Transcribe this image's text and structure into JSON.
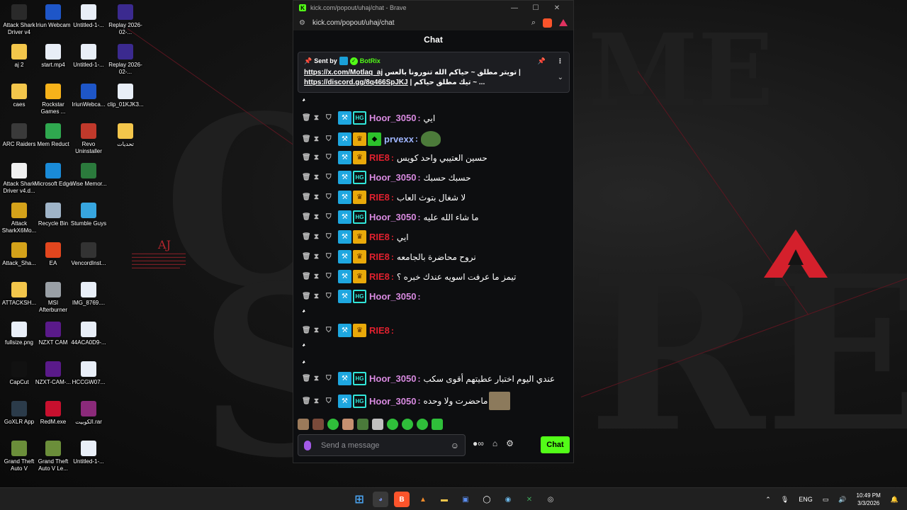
{
  "desktop": {
    "icons": [
      {
        "label": "Attack Shark Driver v4",
        "icon": "mouse-driver-icon",
        "color": "#2a2a2a"
      },
      {
        "label": "Iriun Webcam",
        "icon": "webcam-icon",
        "color": "#1e56c8"
      },
      {
        "label": "Untitled-1-...",
        "icon": "image-file-icon",
        "color": "#e8eef7"
      },
      {
        "label": "Replay 2026-02-...",
        "icon": "video-file-icon",
        "color": "#3b2a8f"
      },
      {
        "label": "aj 2",
        "icon": "folder-icon",
        "color": "#f3c64b"
      },
      {
        "label": "start.mp4",
        "icon": "video-file-icon",
        "color": "#e8eef7"
      },
      {
        "label": "Untitled-1-...",
        "icon": "image-file-icon",
        "color": "#e8eef7"
      },
      {
        "label": "Replay 2026-02-...",
        "icon": "video-file-icon",
        "color": "#3b2a8f"
      },
      {
        "label": "caes",
        "icon": "folder-icon",
        "color": "#f3c64b"
      },
      {
        "label": "Rockstar Games ...",
        "icon": "rockstar-icon",
        "color": "#f6b21a"
      },
      {
        "label": "IriunWebca...",
        "icon": "webcam-icon",
        "color": "#1e56c8"
      },
      {
        "label": "clip_01KJK3...",
        "icon": "video-file-icon",
        "color": "#e8eef7"
      },
      {
        "label": "ARC Raiders",
        "icon": "game-icon",
        "color": "#3a3a3a"
      },
      {
        "label": "Mem Reduct",
        "icon": "memory-icon",
        "color": "#2fa84f"
      },
      {
        "label": "Revo Uninstaller",
        "icon": "uninstaller-icon",
        "color": "#c0392b"
      },
      {
        "label": "تحديات",
        "icon": "folder-icon",
        "color": "#f3c64b"
      },
      {
        "label": "Attack Shark Driver v4.d...",
        "icon": "file-icon",
        "color": "#f0f0f0"
      },
      {
        "label": "Microsoft Edge",
        "icon": "edge-icon",
        "color": "#1a8bd8"
      },
      {
        "label": "Wise Memor...",
        "icon": "memory-icon",
        "color": "#2b7a3c"
      },
      {
        "label": "Attack SharkX6Mo...",
        "icon": "mouse-driver-icon",
        "color": "#d4a21a"
      },
      {
        "label": "Recycle Bin",
        "icon": "recycle-bin-icon",
        "color": "#9fb4c8"
      },
      {
        "label": "Stumble Guys",
        "icon": "game-icon",
        "color": "#37a6e0"
      },
      {
        "label": "Attack_Sha...",
        "icon": "mouse-driver-icon",
        "color": "#d4a21a"
      },
      {
        "label": "EA",
        "icon": "ea-icon",
        "color": "#e2461e"
      },
      {
        "label": "VencordInst...",
        "icon": "vencord-icon",
        "color": "#333333"
      },
      {
        "label": "ATTACKSH...",
        "icon": "folder-icon",
        "color": "#f3c64b"
      },
      {
        "label": "MSI Afterburner",
        "icon": "afterburner-icon",
        "color": "#9aa0a6"
      },
      {
        "label": "IMG_8769....",
        "icon": "image-file-icon",
        "color": "#e8eef7"
      },
      {
        "label": "fullsize.png",
        "icon": "image-file-icon",
        "color": "#e8eef7"
      },
      {
        "label": "NZXT CAM",
        "icon": "nzxt-icon",
        "color": "#5a1a8a"
      },
      {
        "label": "44ACA0D9-...",
        "icon": "image-file-icon",
        "color": "#e8eef7"
      },
      {
        "label": "CapCut",
        "icon": "capcut-icon",
        "color": "#111111"
      },
      {
        "label": "NZXT-CAM-...",
        "icon": "nzxt-icon",
        "color": "#5a1a8a"
      },
      {
        "label": "HCCGW07...",
        "icon": "image-file-icon",
        "color": "#e8eef7"
      },
      {
        "label": "GoXLR App",
        "icon": "goxlr-icon",
        "color": "#2b3b4a"
      },
      {
        "label": "RedM.exe",
        "icon": "redm-icon",
        "color": "#c8102e"
      },
      {
        "label": "الكوبيت.rar",
        "icon": "archive-icon",
        "color": "#8b2a7a"
      },
      {
        "label": "Grand Theft Auto V",
        "icon": "gta-icon",
        "color": "#6b8e3a"
      },
      {
        "label": "Grand Theft Auto V Le...",
        "icon": "gta-icon",
        "color": "#6b8e3a"
      },
      {
        "label": "Untitled-1-...",
        "icon": "image-file-icon",
        "color": "#e8eef7"
      }
    ],
    "aj_logo": "AJ"
  },
  "browser": {
    "title": "kick.com/popout/uhaj/chat - Brave",
    "url": "kick.com/popout/uhaj/chat",
    "minimize": "—",
    "maximize": "☐",
    "close": "✕"
  },
  "chat": {
    "header": "Chat",
    "pinned": {
      "sent_by_label": "Sent by",
      "bot_name": "BotRix",
      "line1_link": "https://x.com/Motlaq_aj",
      "line1_text": "تويتر مطلق ~ حياكم الله تنورونا بالعس |",
      "line2_link": "https://discord.gg/8q466SpJKJ",
      "line2_text": "| تيك مطلق حياكم ~ ..."
    },
    "messages": [
      {
        "user": "Hoor_3050",
        "color": "pink",
        "badges": [
          "mod",
          "sub"
        ],
        "text": "ايي"
      },
      {
        "user": "prvexx",
        "color": "blue",
        "badges": [
          "mod",
          "crown",
          "green"
        ],
        "text": ""
      },
      {
        "user": "RIE8",
        "color": "red",
        "badges": [
          "mod",
          "crown"
        ],
        "text": "حسين العتيبي واحد كويس"
      },
      {
        "user": "Hoor_3050",
        "color": "pink",
        "badges": [
          "mod",
          "sub"
        ],
        "text": "حسبك حسبك"
      },
      {
        "user": "RIE8",
        "color": "red",
        "badges": [
          "mod",
          "crown"
        ],
        "text": "لا شغال بتوث العاب"
      },
      {
        "user": "Hoor_3050",
        "color": "pink",
        "badges": [
          "mod",
          "sub"
        ],
        "text": "ما شاء الله عليه"
      },
      {
        "user": "RIE8",
        "color": "red",
        "badges": [
          "mod",
          "crown"
        ],
        "text": "ايي"
      },
      {
        "user": "RIE8",
        "color": "red",
        "badges": [
          "mod",
          "crown"
        ],
        "text": "نروح محاضرة بالجامعه"
      },
      {
        "user": "RIE8",
        "color": "red",
        "badges": [
          "mod",
          "crown"
        ],
        "text": "تيمز ما عرفت اسويه عندك خبره ؟"
      },
      {
        "user": "Hoor_3050",
        "color": "pink",
        "badges": [
          "mod",
          "sub"
        ],
        "text": ""
      },
      {
        "user": "RIE8",
        "color": "red",
        "badges": [
          "mod",
          "crown"
        ],
        "text": ""
      },
      {
        "user": "Hoor_3050",
        "color": "pink",
        "badges": [
          "mod",
          "sub"
        ],
        "text": "عندي اليوم اختبار عطيتهم أقوى سكب"
      },
      {
        "user": "Hoor_3050",
        "color": "pink",
        "badges": [
          "mod",
          "sub"
        ],
        "text": "ماحضرت ولا وحده"
      }
    ],
    "top_spam_line": "ٌٌٌٌٌٌٌٌٌٌٌٌٌٌٌٌٌٌٌٌٌٌٌٌٌٌٌٌٌٌٌٌٌٌٌٌٌٌٌٌٌٌٌٌٌٌٌٌٌٌٌٌٌٌ",
    "spam_line": "ٌٌٌٌٌٌٌٌٌٌٌٌٌٌٌٌٌٌٌٌٌٌٌٌٌٌٌٌٌٌٌٌٌٌٌٌٌٌٌٌٌٌٌٌٌٌٌٌٌٌٌٌٌٌٌٌٌٌٌٌٌٌٌٌٌٌٌٌٌٌٌٌٌٌٌ",
    "input_placeholder": "Send a message",
    "send_label": "Chat",
    "infinity_label": "∞"
  },
  "taskbar": {
    "language": "ENG",
    "time": "10:49 PM",
    "date": "3/3/2026"
  }
}
